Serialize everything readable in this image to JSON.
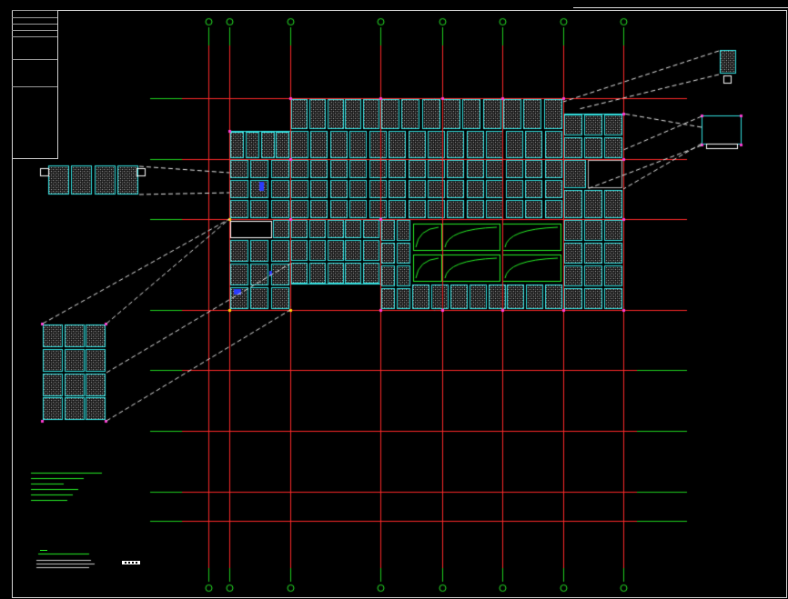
{
  "drawing": {
    "background": "#000000",
    "colors": {
      "axis": "#ff2a2a",
      "axis_ext": "#1fd21f",
      "bubble": "#27e827",
      "panel_border": "#34e6e6",
      "panel_fill": "#101010",
      "hatch": "#c8c8c8",
      "leader": "#e8e8e8",
      "node": "#ff3bd6",
      "green": "#27f227",
      "yellow": "#ffd400",
      "blue": "#2a3cff"
    },
    "icons": [
      "axis-bubble-icon",
      "node-marker-icon",
      "scale-bar-icon"
    ]
  },
  "title_block": {
    "rows": [
      "",
      "",
      "",
      "",
      "",
      "",
      ""
    ],
    "labels": [
      "",
      "",
      "",
      "",
      ""
    ]
  },
  "notes": {
    "lines": [
      "",
      "",
      "",
      "",
      "",
      ""
    ]
  },
  "legend": {
    "title": "",
    "sub": [
      "",
      "",
      ""
    ],
    "scale_label": ""
  },
  "axes": {
    "vertical_labels": [
      "",
      "",
      "",
      "",
      "",
      "",
      "",
      ""
    ],
    "horizontal_labels": [
      "",
      "",
      "",
      "",
      "",
      "",
      "",
      ""
    ]
  }
}
